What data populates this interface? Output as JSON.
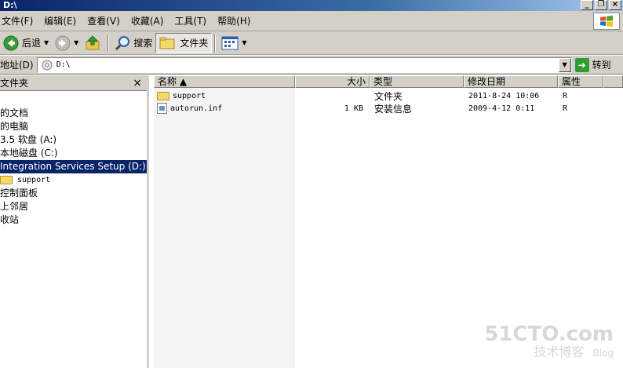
{
  "window": {
    "title": "D:\\"
  },
  "menubar": {
    "items": [
      "文件(F)",
      "编辑(E)",
      "查看(V)",
      "收藏(A)",
      "工具(T)",
      "帮助(H)"
    ]
  },
  "toolbar": {
    "back_label": "后退",
    "search_label": "搜索",
    "folders_label": "文件夹"
  },
  "address": {
    "label": "地址(D)",
    "value": "D:\\",
    "go_label": "转到"
  },
  "folders_pane": {
    "title": "文件夹",
    "close": "×",
    "items": [
      {
        "label": "的文档"
      },
      {
        "label": "的电脑"
      },
      {
        "label": "3.5 软盘 (A:)"
      },
      {
        "label": "本地磁盘 (C:)"
      },
      {
        "label": "Integration Services Setup (D:)"
      },
      {
        "label": "support"
      },
      {
        "label": "控制面板"
      },
      {
        "label": "上邻居"
      },
      {
        "label": "收站"
      }
    ]
  },
  "file_list": {
    "columns": {
      "name": "名称 ▲",
      "size": "大小",
      "type": "类型",
      "modified": "修改日期",
      "attributes": "属性"
    },
    "rows": [
      {
        "name": "support",
        "size": "",
        "type": "文件夹",
        "modified": "2011-8-24 10:06",
        "attributes": "R"
      },
      {
        "name": "autorun.inf",
        "size": "1 KB",
        "type": "安装信息",
        "modified": "2009-4-12 0:11",
        "attributes": "R"
      }
    ]
  },
  "watermark": {
    "line1": "51CTO.com",
    "line2": "技术博客",
    "line3": "Blog"
  }
}
